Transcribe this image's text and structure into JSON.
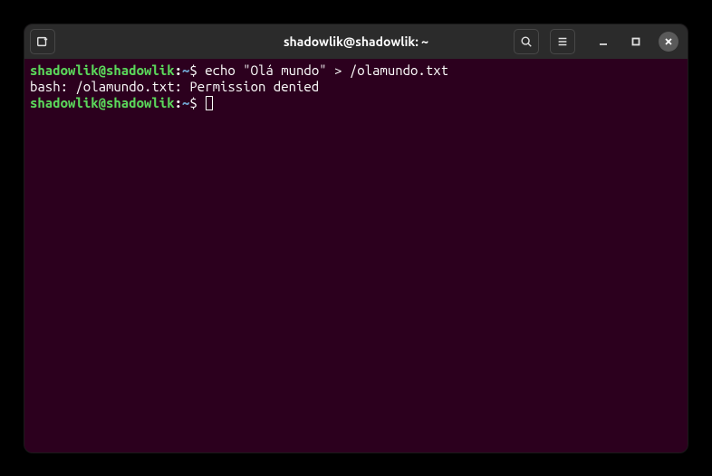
{
  "titlebar": {
    "title": "shadowlik@shadowlik: ~"
  },
  "prompt": {
    "user_host": "shadowlik@shadowlik",
    "colon": ":",
    "path": "~",
    "symbol": "$"
  },
  "lines": {
    "cmd1": " echo \"Olá mundo\" > /olamundo.txt",
    "output1": "bash: /olamundo.txt: Permission denied",
    "cmd2": " "
  },
  "colors": {
    "bg": "#2c001e",
    "titlebar": "#2b2b2b",
    "user_host": "#5bd85b",
    "path": "#6e9fca",
    "text": "#ffffff"
  }
}
